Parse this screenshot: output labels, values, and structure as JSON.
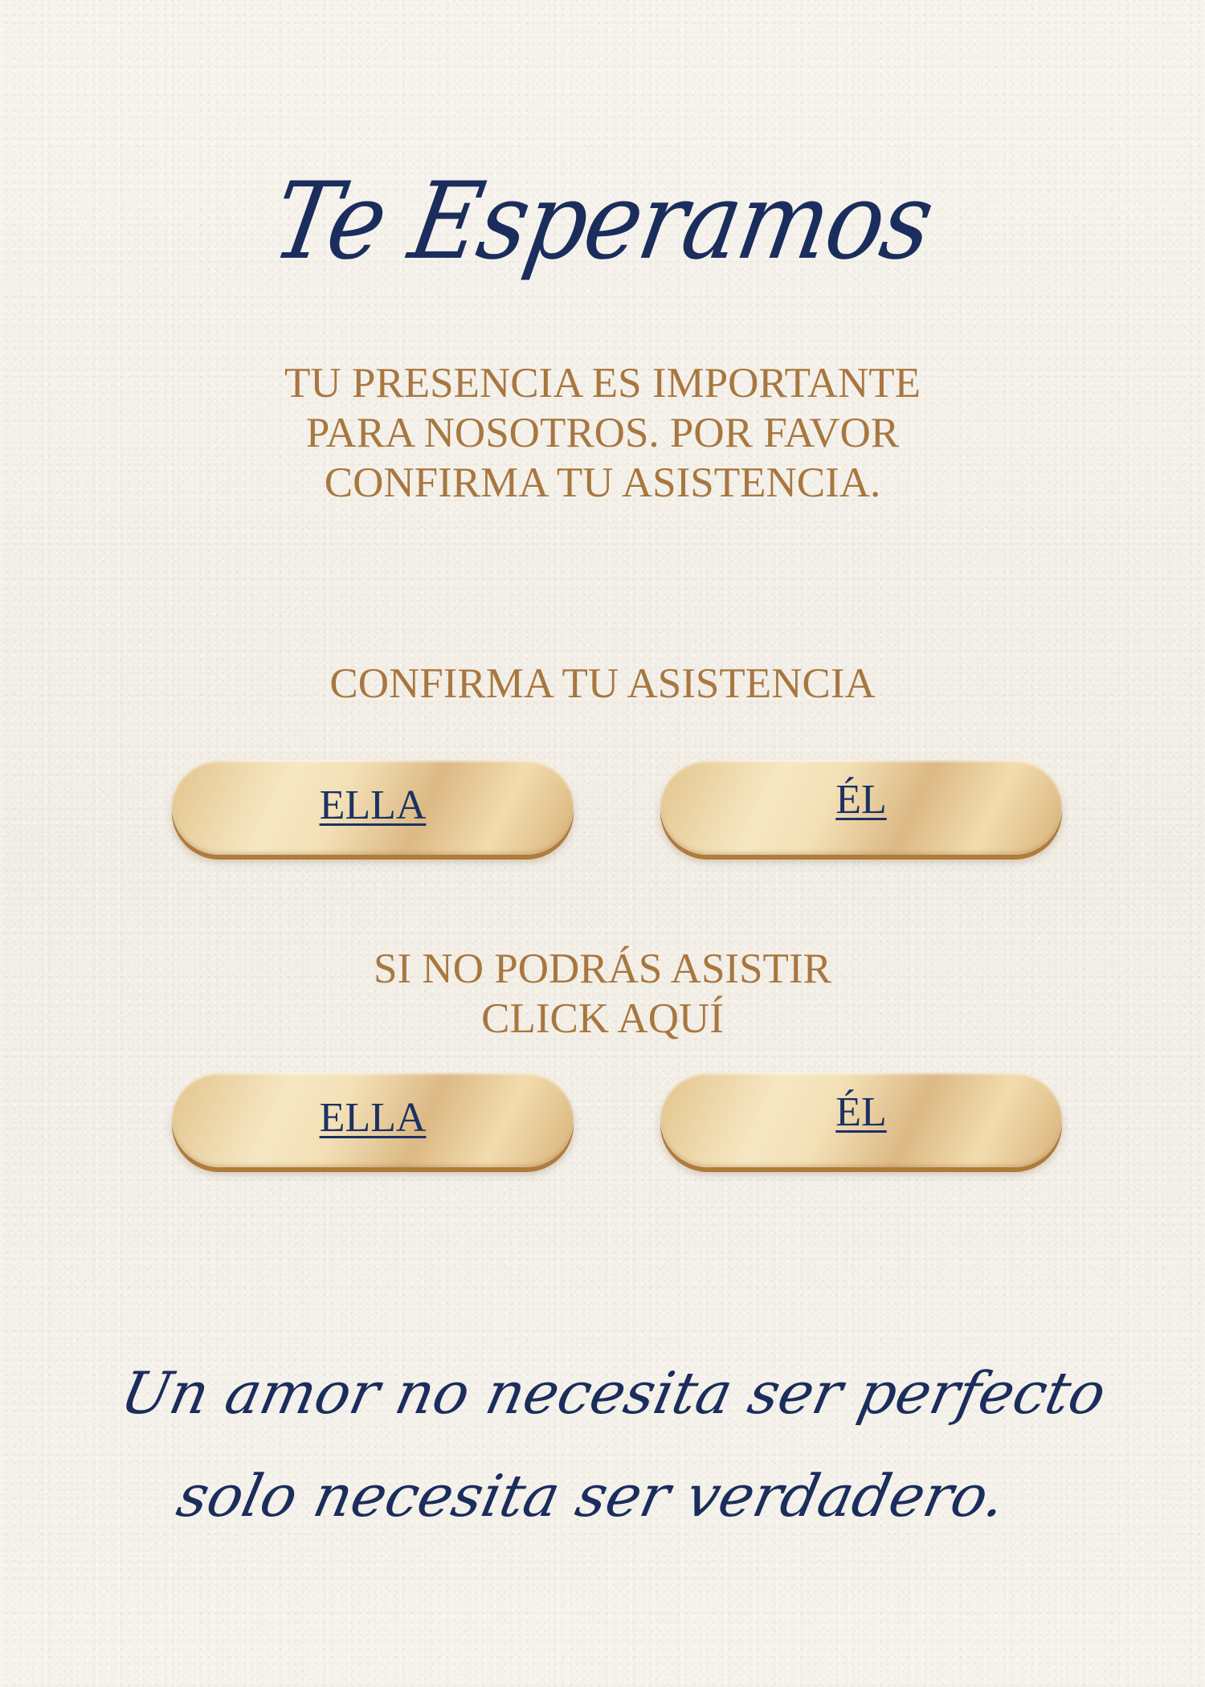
{
  "header": {
    "title": "Te Esperamos"
  },
  "intro": {
    "lines": [
      "TU PRESENCIA ES IMPORTANTE",
      "PARA NOSOTROS. POR FAVOR",
      "CONFIRMA TU ASISTENCIA."
    ]
  },
  "confirm": {
    "heading": "CONFIRMA TU ASISTENCIA",
    "ella_label": "ELLA",
    "el_label": "ÉL"
  },
  "decline": {
    "heading_lines": [
      "SI NO PODRÁS ASISTIR",
      "CLICK AQUÍ"
    ],
    "ella_label": "ELLA",
    "el_label": "ÉL"
  },
  "quote": {
    "lines": [
      "Un amor no necesita ser perfecto",
      "solo necesita ser verdadero."
    ]
  },
  "colors": {
    "navy": "#1a2d5c",
    "gold_text": "#a8773f",
    "gold_button": "#e2c48c",
    "paper": "#f4f1ea"
  }
}
